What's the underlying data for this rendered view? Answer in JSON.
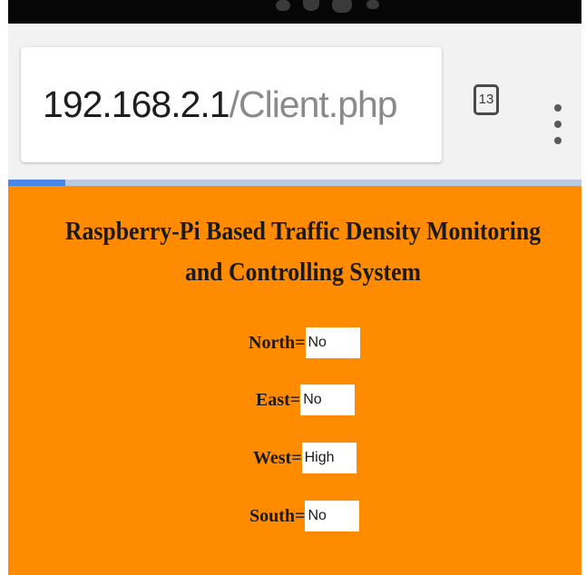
{
  "browser": {
    "url_host": "192.168.2.1",
    "url_path": "/Client.php",
    "tab_count": "13",
    "page_load_progress": 0.1
  },
  "page": {
    "title": "Raspberry-Pi Based Traffic Density Monitoring and Controlling System",
    "background_color": "#ff8c00",
    "fields": [
      {
        "label": "North=",
        "value": "No"
      },
      {
        "label": "East=",
        "value": "No"
      },
      {
        "label": "West=",
        "value": "High"
      },
      {
        "label": "South=",
        "value": "No"
      }
    ]
  },
  "icons": {
    "tab_switcher": "tab-switcher-icon",
    "menu": "more-vert-icon"
  }
}
